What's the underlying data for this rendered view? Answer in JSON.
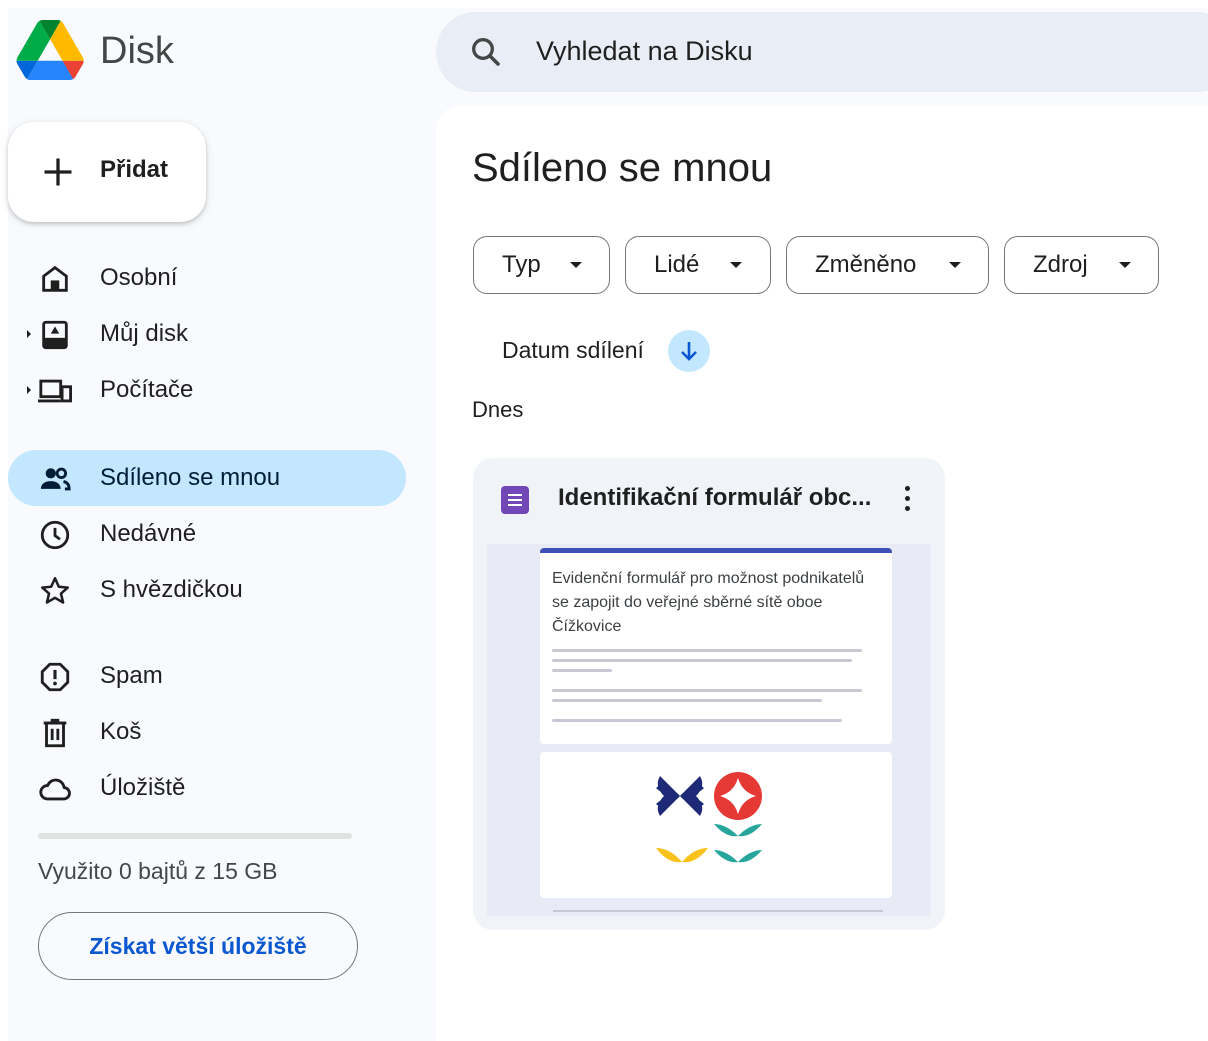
{
  "app": {
    "name": "Disk"
  },
  "search": {
    "placeholder": "Vyhledat na Disku"
  },
  "new_button": {
    "label": "Přidat"
  },
  "nav": {
    "items": [
      {
        "id": "osobni",
        "label": "Osobní",
        "icon": "home-icon"
      },
      {
        "id": "muj-disk",
        "label": "Můj disk",
        "icon": "my-drive-icon"
      },
      {
        "id": "pocitace",
        "label": "Počítače",
        "icon": "computers-icon"
      },
      {
        "id": "sdileno",
        "label": "Sdíleno se mnou",
        "icon": "people-icon",
        "active": true
      },
      {
        "id": "nedavne",
        "label": "Nedávné",
        "icon": "clock-icon"
      },
      {
        "id": "s-hvezdickou",
        "label": "S hvězdičkou",
        "icon": "star-icon"
      },
      {
        "id": "spam",
        "label": "Spam",
        "icon": "spam-icon"
      },
      {
        "id": "kos",
        "label": "Koš",
        "icon": "trash-icon"
      },
      {
        "id": "uloziste",
        "label": "Úložiště",
        "icon": "cloud-icon"
      }
    ]
  },
  "storage": {
    "used_fraction": 0,
    "text": "Využito 0 bajtů z 15 GB",
    "button_label": "Získat větší úložiště"
  },
  "main": {
    "title": "Sdíleno se mnou",
    "filters": [
      "Typ",
      "Lidé",
      "Změněno",
      "Zdroj"
    ],
    "sort_label": "Datum sdílení",
    "section_label": "Dnes",
    "files": [
      {
        "name": "Identifikační formulář obc...",
        "type_icon": "google-forms-icon",
        "preview_title": "Evidenční formulář pro možnost podnikatelů se zapojit do veřejné sběrné sítě oboe Čížkovice"
      }
    ]
  },
  "colors": {
    "accent": "#0b57d0",
    "active_nav": "#c2e7ff",
    "forms_purple": "#7248b9",
    "search_bg": "#e9eef6"
  }
}
